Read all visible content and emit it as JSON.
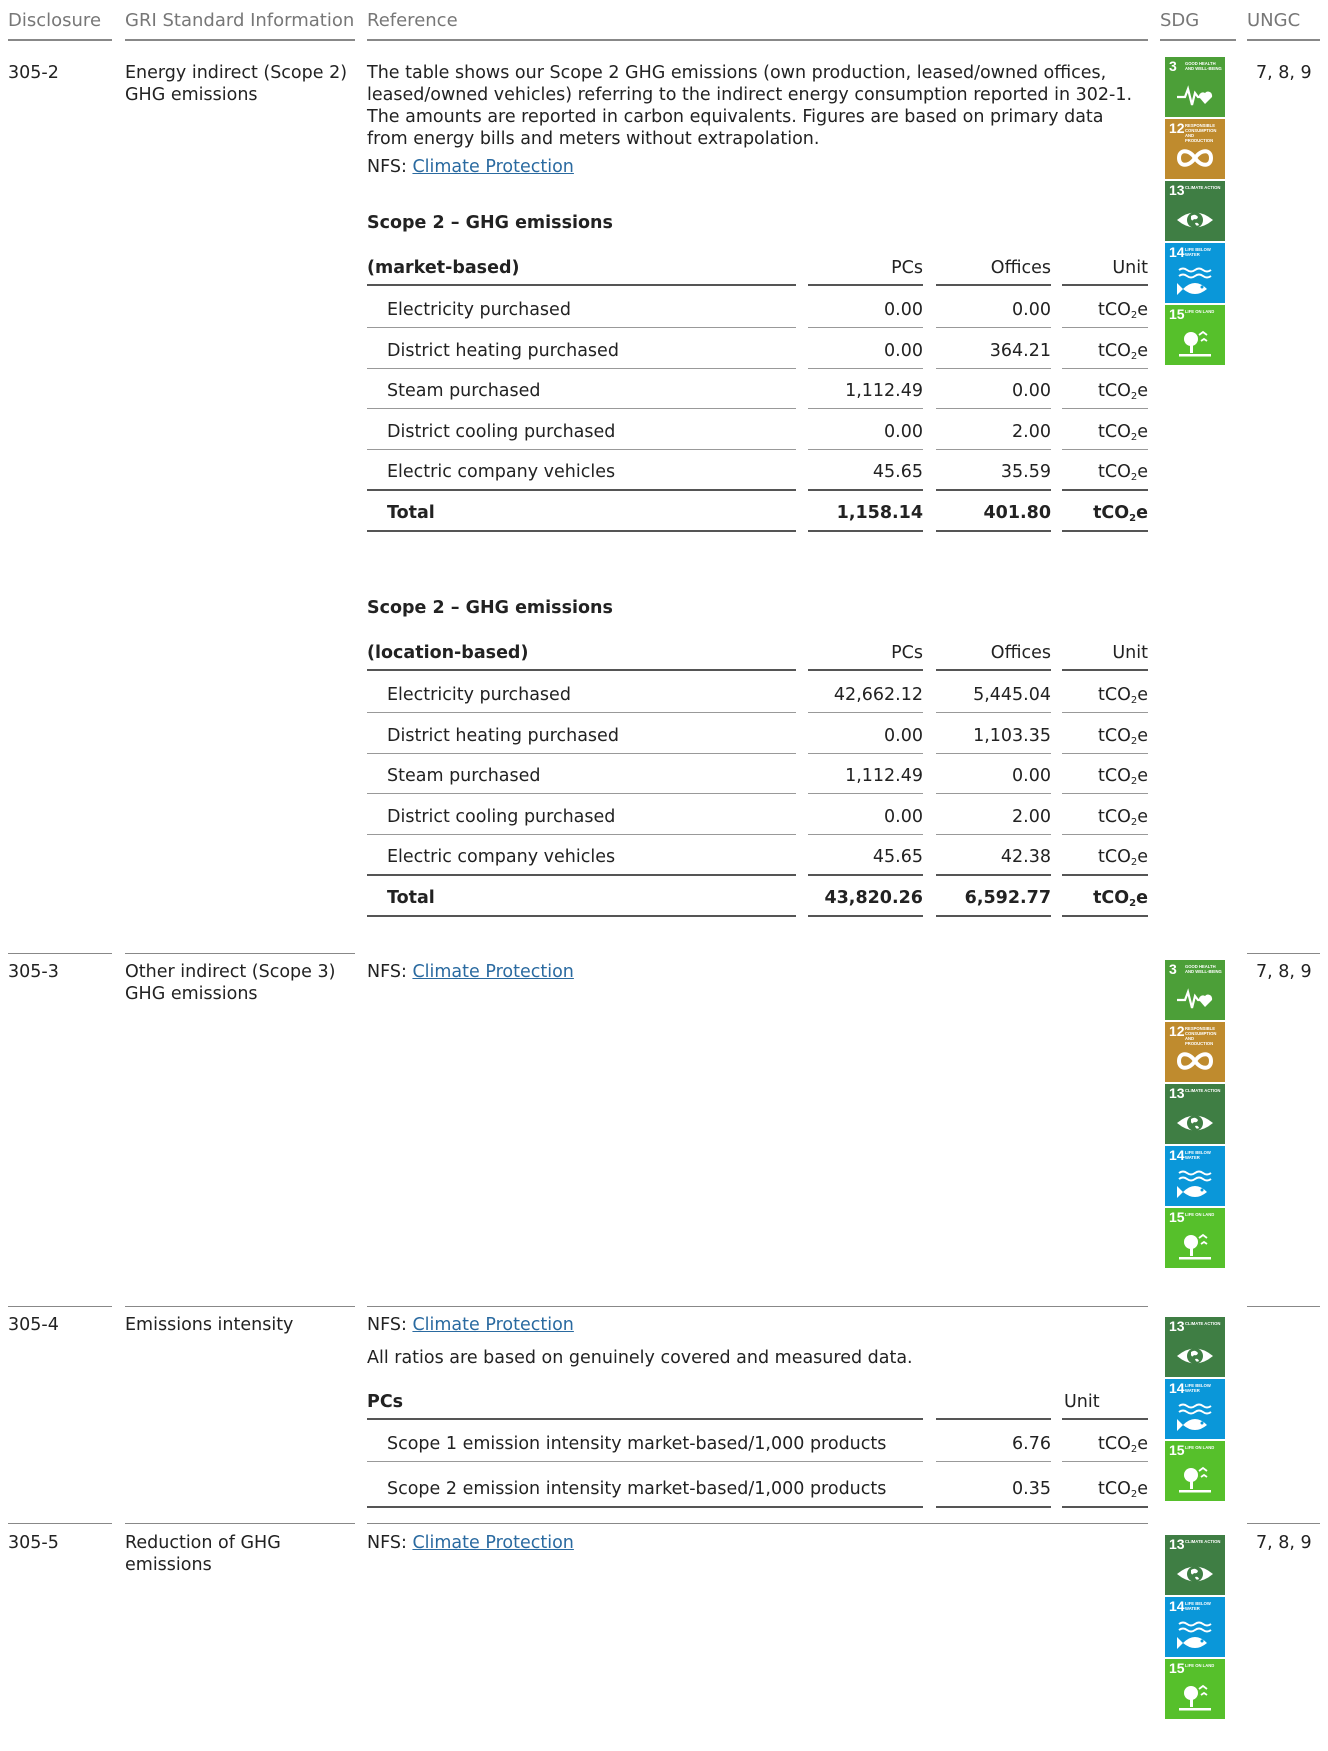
{
  "header": {
    "disclosure": "Disclosure",
    "gri": "GRI Standard Information",
    "reference": "Reference",
    "sdg": "SDG",
    "ungc": "UNGC"
  },
  "nfs_prefix": "NFS:",
  "link_label": "Climate Protection",
  "sdg_goals": {
    "g3": {
      "num": "3",
      "label": "Good health and well-being",
      "color": "#4c9f38",
      "icon": "heartbeat-icon"
    },
    "g12": {
      "num": "12",
      "label": "Responsible consumption and production",
      "color": "#bf8b2e",
      "icon": "infinity-icon"
    },
    "g13": {
      "num": "13",
      "label": "Climate action",
      "color": "#3f7e44",
      "icon": "eye-globe-icon"
    },
    "g14": {
      "num": "14",
      "label": "Life below water",
      "color": "#0a97d9",
      "icon": "fish-icon"
    },
    "g15": {
      "num": "15",
      "label": "Life on land",
      "color": "#56c02b",
      "icon": "tree-icon"
    }
  },
  "rows": {
    "r1": {
      "code": "305-2",
      "title_1": "Energy indirect (Scope 2)",
      "title_2": "GHG emissions",
      "para_1": "The table shows our Scope 2 GHG emissions (own production, leased/owned offices,",
      "para_2": "leased/owned vehicles) referring to the indirect energy consumption reported in 302-1.",
      "para_3": "The amounts are reported in carbon equivalents. Figures are based on primary data",
      "para_4": "from energy bills and meters without extrapolation.",
      "ungc": "7, 8, 9",
      "table_a": {
        "title": "Scope 2 – GHG emissions",
        "basis": "(market-based)",
        "col_pcs": "PCs",
        "col_offices": "Offices",
        "col_unit": "Unit",
        "rows": [
          {
            "label": "Electricity purchased",
            "pcs": "0.00",
            "offices": "0.00"
          },
          {
            "label": "District heating purchased",
            "pcs": "0.00",
            "offices": "364.21"
          },
          {
            "label": "Steam purchased",
            "pcs": "1,112.49",
            "offices": "0.00"
          },
          {
            "label": "District cooling purchased",
            "pcs": "0.00",
            "offices": "2.00"
          },
          {
            "label": "Electric company vehicles",
            "pcs": "45.65",
            "offices": "35.59"
          }
        ],
        "total": {
          "label": "Total",
          "pcs": "1,158.14",
          "offices": "401.80"
        }
      },
      "table_b": {
        "title": "Scope 2 – GHG emissions",
        "basis": "(location-based)",
        "col_pcs": "PCs",
        "col_offices": "Offices",
        "col_unit": "Unit",
        "rows": [
          {
            "label": "Electricity purchased",
            "pcs": "42,662.12",
            "offices": "5,445.04"
          },
          {
            "label": "District heating purchased",
            "pcs": "0.00",
            "offices": "1,103.35"
          },
          {
            "label": "Steam purchased",
            "pcs": "1,112.49",
            "offices": "0.00"
          },
          {
            "label": "District cooling purchased",
            "pcs": "0.00",
            "offices": "2.00"
          },
          {
            "label": "Electric company vehicles",
            "pcs": "45.65",
            "offices": "42.38"
          }
        ],
        "total": {
          "label": "Total",
          "pcs": "43,820.26",
          "offices": "6,592.77"
        }
      }
    },
    "r2": {
      "code": "305-3",
      "title_1": "Other indirect (Scope 3)",
      "title_2": "GHG emissions",
      "ungc": "7, 8, 9"
    },
    "r3": {
      "code": "305-4",
      "title_1": "Emissions intensity",
      "note": "All ratios are based on genuinely covered and measured data.",
      "table": {
        "head": "PCs",
        "col_unit": "Unit",
        "rows": [
          {
            "label": "Scope 1 emission intensity market-based/1,000 products",
            "value": "6.76"
          },
          {
            "label": "Scope 2 emission intensity market-based/1,000 products",
            "value": "0.35"
          }
        ]
      }
    },
    "r4": {
      "code": "305-5",
      "title_1": "Reduction of GHG",
      "title_2": "emissions",
      "ungc": "7, 8, 9"
    }
  },
  "unit_main": "tCO",
  "unit_sub": "2",
  "unit_end": "e"
}
